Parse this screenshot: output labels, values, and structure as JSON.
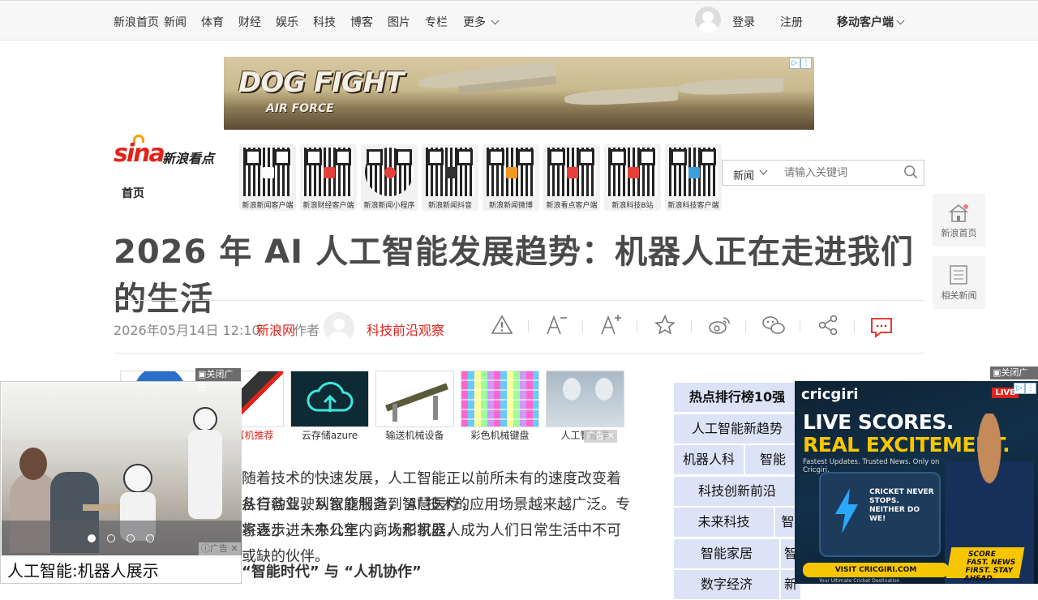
{
  "topnav": {
    "items": [
      "新浪首页",
      "新闻",
      "体育",
      "财经",
      "娱乐",
      "科技",
      "博客",
      "图片",
      "专栏",
      "更多"
    ],
    "login": "登录",
    "register": "注册",
    "mobile_sina": "移动客户端"
  },
  "banner": {
    "title": "DOG FIGHT",
    "subtitle": "AIR FORCE"
  },
  "logo": {
    "brand": "sina",
    "name": "新浪看点"
  },
  "breadcrumb": "首页",
  "qr_codes": [
    {
      "label": "新浪新闻客户端"
    },
    {
      "label": "新浪财经客户端"
    },
    {
      "label": "新浪新闻小程序"
    },
    {
      "label": "新浪新闻抖音"
    },
    {
      "label": "新浪新闻微博"
    },
    {
      "label": "新浪看点客户端"
    },
    {
      "label": "新浪科技B站"
    },
    {
      "label": "新浪科技客户端"
    }
  ],
  "search": {
    "scope": "新闻",
    "placeholder": "请输入关键词"
  },
  "side_tools": {
    "home": "新浪首页",
    "related": "相关新闻"
  },
  "article": {
    "headline": "2026 年 AI 人工智能发展趋势：机器人正在走进我们的生活",
    "date": "2026年05月14日 12:10",
    "source": "新浪网",
    "follow_label": "作者",
    "author": "科技前沿观察",
    "paragraphs": [
      "随着技术的快速发展，人工智能正以前所未有的速度改变着各行各业，从智能制造到智慧医疗，",
      "从自动驾驶到家庭服务， AI 技术的应用场景越来越广泛。专家表示，未来几年内，人形机器人",
      "将逐步进入办公室、商场和家庭，成为人们日常生活中不可或缺的伙伴。"
    ],
    "subheading": "“智能时代” 与 “人机协作”"
  },
  "recommendations": [
    {
      "label": ""
    },
    {
      "label": "智能耳机推荐"
    },
    {
      "label": "云存储azure"
    },
    {
      "label": "输送机械设备"
    },
    {
      "label": "彩色机械键盘"
    },
    {
      "label": "人工智能学"
    }
  ],
  "ranking": {
    "title": "热点排行榜10强",
    "rows": [
      [
        "人工智能新趋势"
      ],
      [
        "机器人科",
        "智能"
      ],
      [
        "科技创新前沿"
      ],
      [
        "未来科技",
        "智"
      ],
      [
        "智能家居",
        "智"
      ],
      [
        "数字经济",
        "新"
      ]
    ]
  },
  "float_left": {
    "close": "关闭广告",
    "caption": "人工智能:机器人展示",
    "ad_label": "广告",
    "slides": 4,
    "active_slide": 0
  },
  "float_right": {
    "close": "关闭广告",
    "brand": "cricgiri",
    "live": "LIVE",
    "headline1": "LIVE SCORES.",
    "headline2": "REAL EXCITEMENT.",
    "tagline": "Fastest Updates. Trusted News. Only on Cricgiri.",
    "phone_text": "CRICKET NEVER STOPS. NEITHER DO WE!",
    "cta": "VISIT CRICGIRI.COM",
    "badge": "SCORE FAST. NEWS FIRST. STAY AHEAD.",
    "footer": "Your Ultimate Cricket Destination"
  },
  "mini_ad_label": "广告",
  "colors": {
    "accent": "#e2231a",
    "rank_bg": "#dde3f7",
    "nav_bg": "#f7f7f7"
  }
}
